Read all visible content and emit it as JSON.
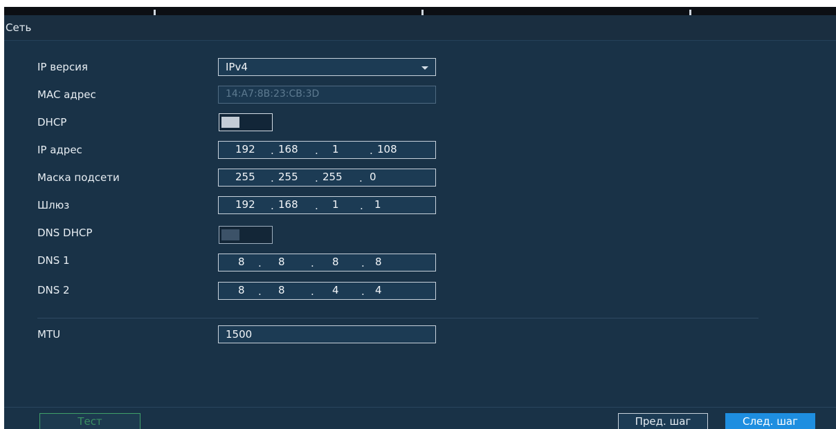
{
  "window": {
    "title": "Сеть"
  },
  "form": {
    "ip_version": {
      "label": "IP версия",
      "value": "IPv4"
    },
    "mac": {
      "label": "MAC адрес",
      "value": "14:A7:8B:23:CB:3D"
    },
    "dhcp": {
      "label": "DHCP",
      "enabled": true
    },
    "ip_address": {
      "label": "IP адрес",
      "octets": [
        "192",
        "168",
        "1",
        "108"
      ]
    },
    "subnet_mask": {
      "label": "Маска подсети",
      "octets": [
        "255",
        "255",
        "255",
        "0"
      ]
    },
    "gateway": {
      "label": "Шлюз",
      "octets": [
        "192",
        "168",
        "1",
        "1"
      ]
    },
    "dns_dhcp": {
      "label": "DNS DHCP",
      "enabled": false
    },
    "dns1": {
      "label": "DNS 1",
      "octets": [
        "8",
        "8",
        "8",
        "8"
      ]
    },
    "dns2": {
      "label": "DNS 2",
      "octets": [
        "8",
        "8",
        "4",
        "4"
      ]
    },
    "mtu": {
      "label": "MTU",
      "value": "1500"
    }
  },
  "buttons": {
    "test": "Тест",
    "prev": "Пред. шаг",
    "next": "След. шаг"
  },
  "icons": {
    "dropdown": "chevron-down-icon"
  },
  "colors": {
    "background": "#193247",
    "accent": "#1e8ee0",
    "test_button": "#3fa06a"
  }
}
